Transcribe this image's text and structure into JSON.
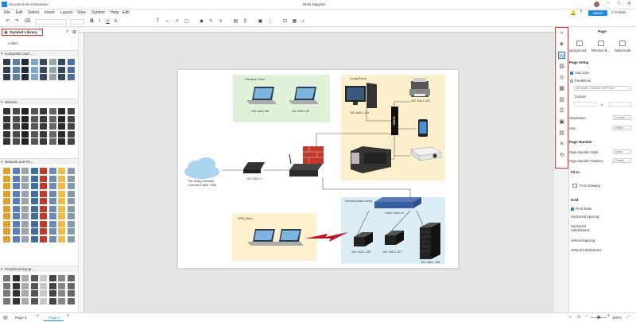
{
  "app": {
    "name": "Wondershare EdrawMax",
    "document_title": "WAN Diagram",
    "share_label": "Share",
    "publish_label": "Publish"
  },
  "menu": [
    "File",
    "Edit",
    "Select",
    "Insert",
    "Layout",
    "View",
    "Symbol",
    "Help",
    "Edit"
  ],
  "left_panel": {
    "title": "Symbol Library",
    "collect": "collect",
    "categories": [
      "Computers and ...",
      "Servers",
      "Network and Pe...",
      "Peripheral Equip..."
    ]
  },
  "diagram": {
    "groups": {
      "wireless": "Wireless Client",
      "living_room": "Living Room",
      "servers": "Servers (back room)",
      "vpn": "VPN Client"
    },
    "labels": {
      "laptop1_ip": "192.168.1.68",
      "laptop2_ip": "192.168.1.69",
      "pc_ip": "192.168.1.115",
      "printer_ip": "192.168.1.202",
      "internet": "The Scary Internets",
      "internet_sub": "Comcast Cable 7/384",
      "modem_ip": "192.168.1.1",
      "switch_name": "Cisco 2600 XL",
      "server1_ip": "192.168.1.106",
      "server2_ip": "192.168.1.107",
      "server3_ip": "192.168.1.108",
      "hub": "CISCO"
    }
  },
  "right_panel": {
    "title": "Page",
    "top_icons": [
      "Background",
      "Remove B...",
      "Watermark"
    ],
    "page_setup": "Page Setup",
    "auto_size": "Auto Size",
    "predefined": "Predefined",
    "paper": "A4 sheet, 210mm x 297 mm",
    "custom": "Custom",
    "times": "x",
    "orientation_label": "Orientation:",
    "orientation_value": "Landsc...",
    "unit_label": "Unit:",
    "unit_value": "Millim...",
    "page_number": "Page Number",
    "page_number_style_label": "Page Number Style:",
    "page_number_style_value": "None",
    "page_number_position_label": "Page Number Position:",
    "page_number_position_value": "Center",
    "fit_to": "Fit to",
    "fit_to_drawing": "Fit to Drawing",
    "grid": "Grid",
    "fit_to_ruler": "Fit to Ruler",
    "h_spacing": "Horizontal Spacing:",
    "h_subdiv": "Horizontal Subdivisions:",
    "v_spacing": "Vertical Spacing:",
    "v_subdiv": "Vertical Subdivisions:"
  },
  "status": {
    "page_selector": "Page-1",
    "active_tab": "Page-1",
    "add": "+",
    "zoom": "100%"
  },
  "colors": {
    "accent": "#1e88e5",
    "highlight_border": "#e53935",
    "wireless_bg": "#dff1d8",
    "living_bg": "#fcefcc",
    "servers_bg": "#dbeef6",
    "vpn_bg": "#fcf1cc"
  }
}
